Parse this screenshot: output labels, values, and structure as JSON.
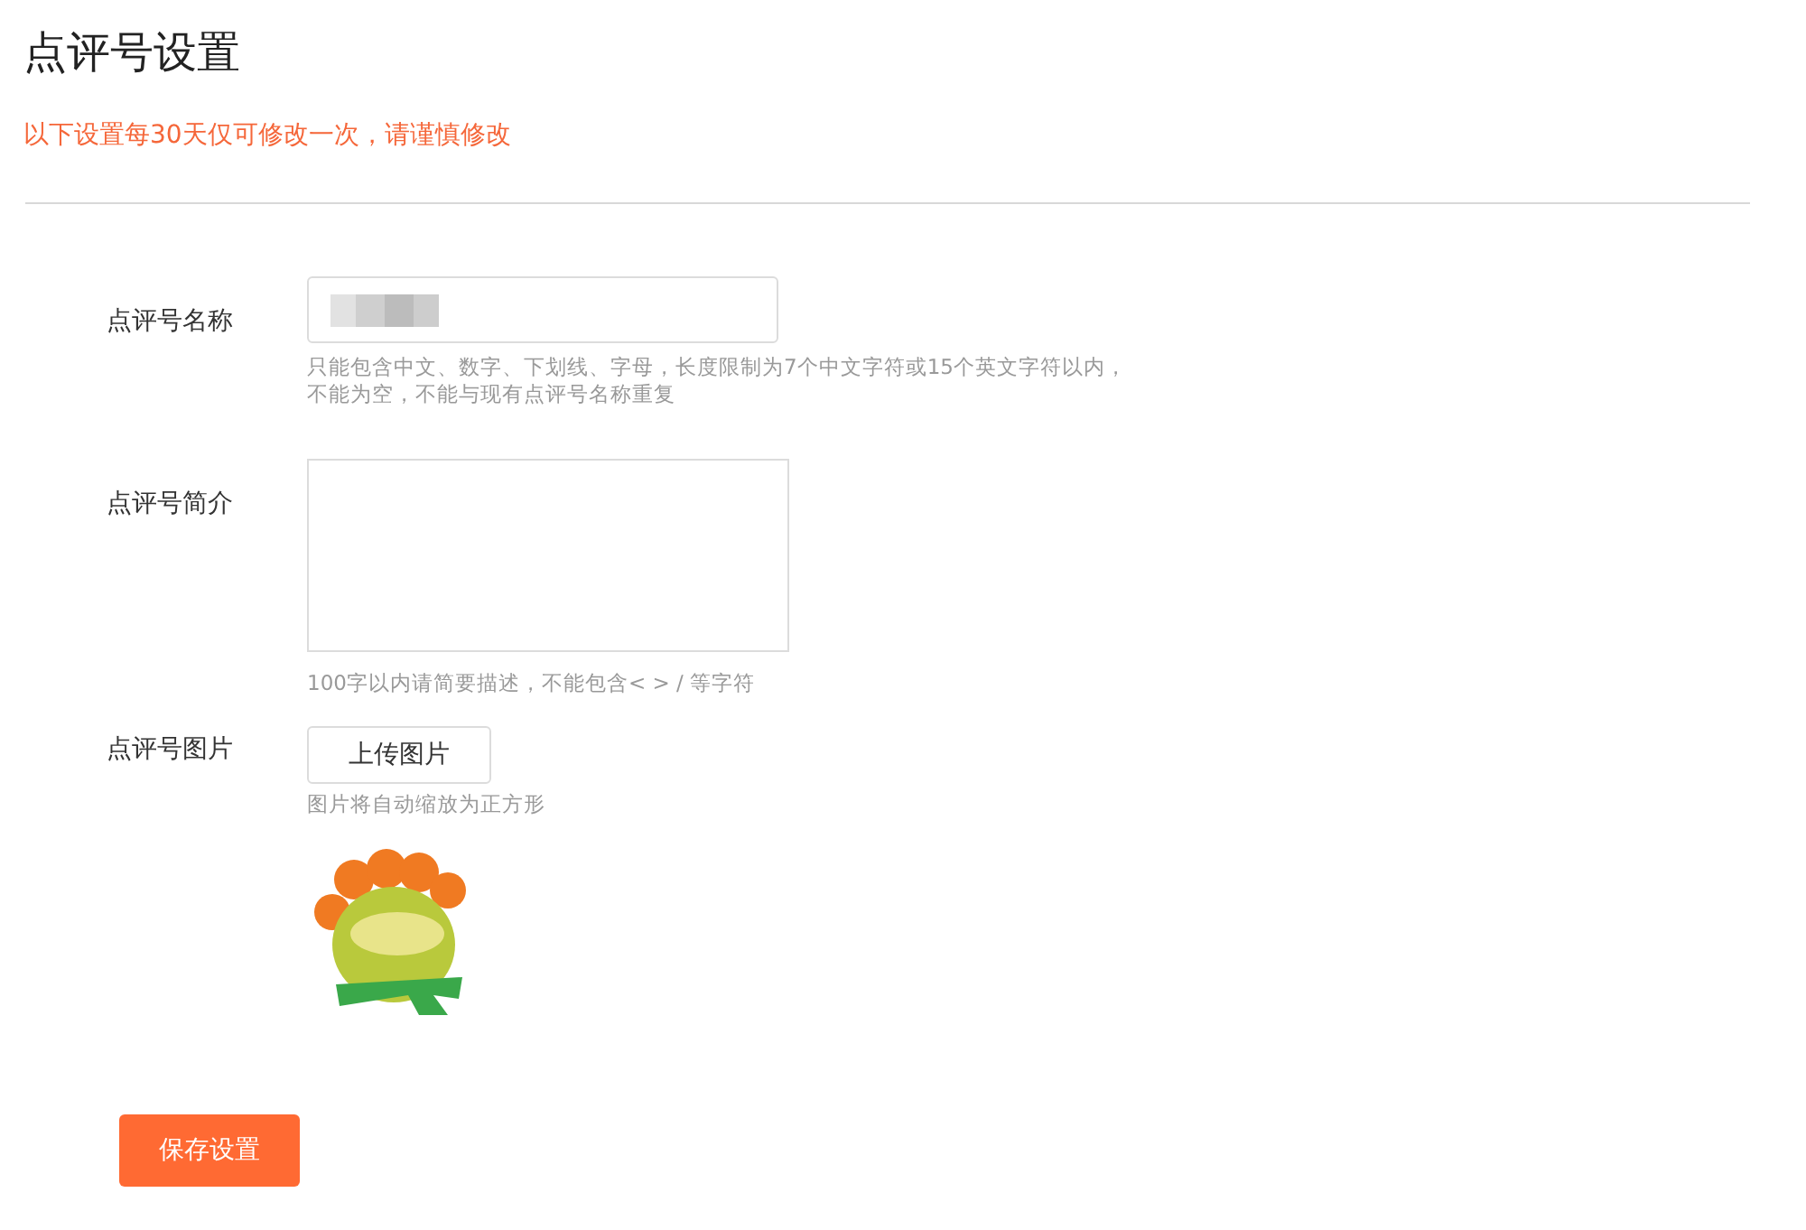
{
  "title": "点评号设置",
  "notice": "以下设置每30天仅可修改一次，请谨慎修改",
  "fields": [
    {
      "kind": "text",
      "label": "点评号名称",
      "hints": [
        "只能包含中文、数字、下划线、字母，长度限制为7个中文字符或15个英文字符以内，",
        "不能为空，不能与现有点评号名称重复"
      ]
    },
    {
      "kind": "textarea",
      "label": "点评号简介",
      "hints": [
        "100字以内请简要描述，不能包含< > / 等字符"
      ]
    },
    {
      "label": "点评号图片",
      "button": "上传图片",
      "hints": [
        "图片将自动缩放为正方形"
      ]
    }
  ],
  "save_button": "保存设置"
}
